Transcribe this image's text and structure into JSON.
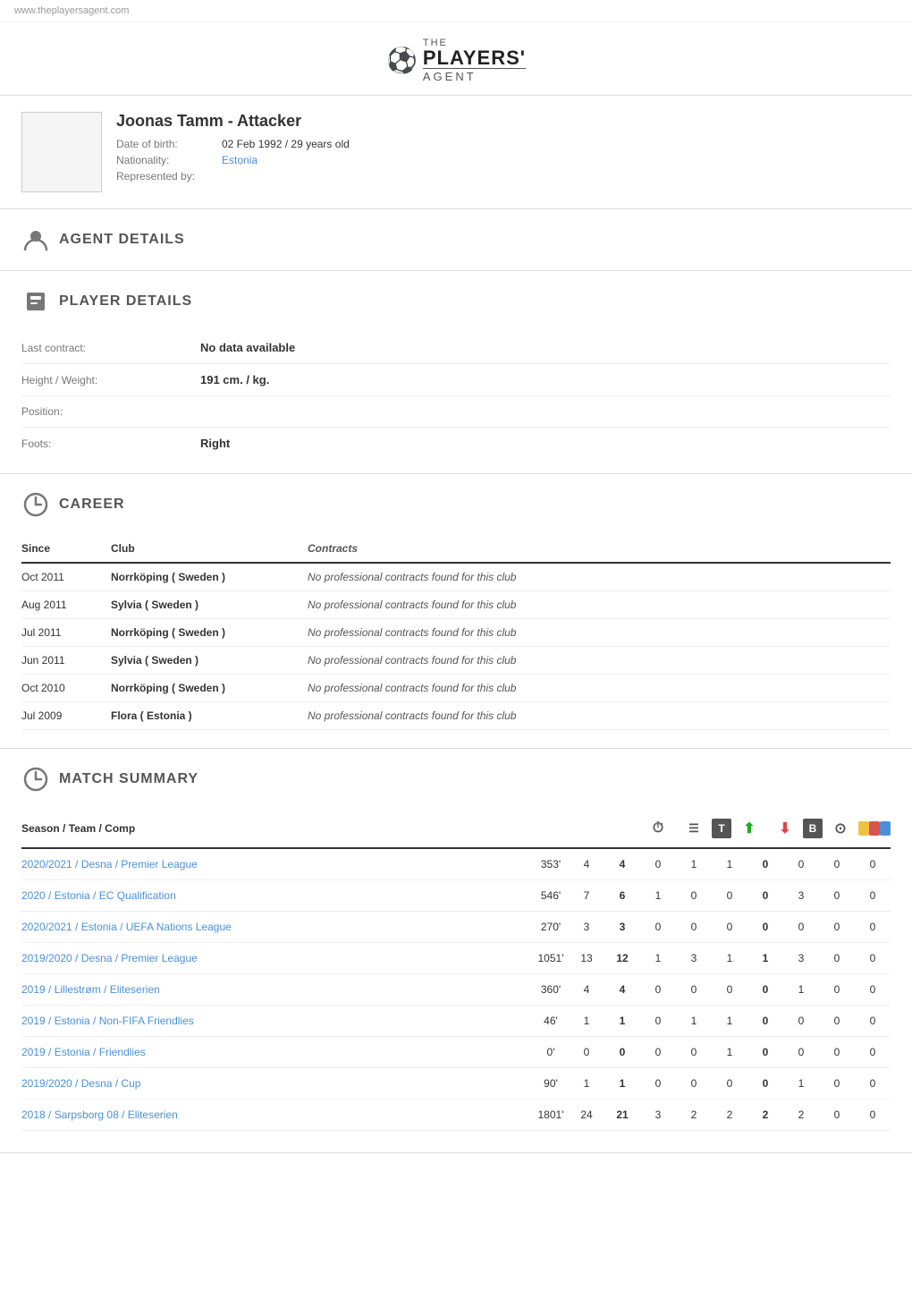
{
  "site": {
    "url": "www.theplayersagent.com"
  },
  "logo": {
    "the": "THE",
    "players": "PLAYERS'",
    "agent": "AGENT"
  },
  "player": {
    "name": "Joonas Tamm",
    "position_label": "Attacker",
    "date_of_birth_label": "Date of birth:",
    "date_of_birth_value": "02 Feb 1992",
    "age": "29 years old",
    "nationality_label": "Nationality:",
    "nationality_value": "Estonia",
    "represented_label": "Represented by:"
  },
  "sections": {
    "agent_details": "AGENT DETAILS",
    "player_details": "PLAYER DETAILS",
    "career": "CAREER",
    "match_summary": "MATCH SUMMARY"
  },
  "player_details_rows": [
    {
      "label": "Last contract:",
      "value": "No data available"
    },
    {
      "label": "Height / Weight:",
      "value": "191 cm. / kg."
    },
    {
      "label": "Position:",
      "value": ""
    },
    {
      "label": "Foots:",
      "value": "Right"
    }
  ],
  "career_headers": [
    "Since",
    "Club",
    "Contracts"
  ],
  "career_rows": [
    {
      "since": "Oct 2011",
      "club": "Norrköping ( Sweden )",
      "contracts": "No professional contracts found for this club"
    },
    {
      "since": "Aug 2011",
      "club": "Sylvia ( Sweden )",
      "contracts": "No professional contracts found for this club"
    },
    {
      "since": "Jul 2011",
      "club": "Norrköping ( Sweden )",
      "contracts": "No professional contracts found for this club"
    },
    {
      "since": "Jun 2011",
      "club": "Sylvia ( Sweden )",
      "contracts": "No professional contracts found for this club"
    },
    {
      "since": "Oct 2010",
      "club": "Norrköping ( Sweden )",
      "contracts": "No professional contracts found for this club"
    },
    {
      "since": "Jul 2009",
      "club": "Flora ( Estonia )",
      "contracts": "No professional contracts found for this club"
    }
  ],
  "match_summary_headers": {
    "season": "Season / Team / Comp",
    "cols": [
      "⏱",
      "☰",
      "T",
      "⬆",
      "⬇",
      "B",
      "⊙",
      "◆",
      "◆",
      "◆"
    ]
  },
  "match_rows": [
    {
      "season": "2020/2021 / Desna / Premier League",
      "c1": "353'",
      "c2": "4",
      "c3": "4",
      "c4": "0",
      "c5": "1",
      "c6": "1",
      "c7": "0",
      "c8": "0",
      "c9": "0",
      "c10": "0"
    },
    {
      "season": "2020 / Estonia / EC Qualification",
      "c1": "546'",
      "c2": "7",
      "c3": "6",
      "c4": "1",
      "c5": "0",
      "c6": "0",
      "c7": "0",
      "c8": "3",
      "c9": "0",
      "c10": "0"
    },
    {
      "season": "2020/2021 / Estonia / UEFA Nations League",
      "c1": "270'",
      "c2": "3",
      "c3": "3",
      "c4": "0",
      "c5": "0",
      "c6": "0",
      "c7": "0",
      "c8": "0",
      "c9": "0",
      "c10": "0"
    },
    {
      "season": "2019/2020 / Desna / Premier League",
      "c1": "1051'",
      "c2": "13",
      "c3": "12",
      "c4": "1",
      "c5": "3",
      "c6": "1",
      "c7": "1",
      "c8": "3",
      "c9": "0",
      "c10": "0"
    },
    {
      "season": "2019 / Lillestrøm / Eliteserien",
      "c1": "360'",
      "c2": "4",
      "c3": "4",
      "c4": "0",
      "c5": "0",
      "c6": "0",
      "c7": "0",
      "c8": "1",
      "c9": "0",
      "c10": "0"
    },
    {
      "season": "2019 / Estonia / Non-FIFA Friendlies",
      "c1": "46'",
      "c2": "1",
      "c3": "1",
      "c4": "0",
      "c5": "1",
      "c6": "1",
      "c7": "0",
      "c8": "0",
      "c9": "0",
      "c10": "0"
    },
    {
      "season": "2019 / Estonia / Friendlies",
      "c1": "0'",
      "c2": "0",
      "c3": "0",
      "c4": "0",
      "c5": "0",
      "c6": "1",
      "c7": "0",
      "c8": "0",
      "c9": "0",
      "c10": "0"
    },
    {
      "season": "2019/2020 / Desna / Cup",
      "c1": "90'",
      "c2": "1",
      "c3": "1",
      "c4": "0",
      "c5": "0",
      "c6": "0",
      "c7": "0",
      "c8": "1",
      "c9": "0",
      "c10": "0"
    },
    {
      "season": "2018 / Sarpsborg 08 / Eliteserien",
      "c1": "1801'",
      "c2": "24",
      "c3": "21",
      "c4": "3",
      "c5": "2",
      "c6": "2",
      "c7": "2",
      "c8": "2",
      "c9": "0",
      "c10": "0"
    }
  ],
  "bold_cols": [
    "c3",
    "c7"
  ]
}
